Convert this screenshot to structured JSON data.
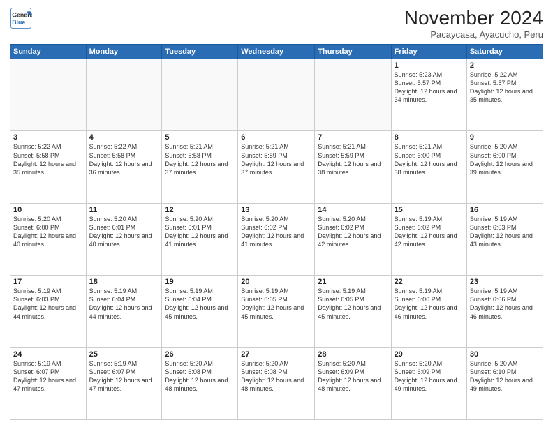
{
  "logo": {
    "general": "General",
    "blue": "Blue"
  },
  "header": {
    "month": "November 2024",
    "location": "Pacaycasa, Ayacucho, Peru"
  },
  "weekdays": [
    "Sunday",
    "Monday",
    "Tuesday",
    "Wednesday",
    "Thursday",
    "Friday",
    "Saturday"
  ],
  "weeks": [
    [
      {
        "day": "",
        "info": ""
      },
      {
        "day": "",
        "info": ""
      },
      {
        "day": "",
        "info": ""
      },
      {
        "day": "",
        "info": ""
      },
      {
        "day": "",
        "info": ""
      },
      {
        "day": "1",
        "info": "Sunrise: 5:23 AM\nSunset: 5:57 PM\nDaylight: 12 hours\nand 34 minutes."
      },
      {
        "day": "2",
        "info": "Sunrise: 5:22 AM\nSunset: 5:57 PM\nDaylight: 12 hours\nand 35 minutes."
      }
    ],
    [
      {
        "day": "3",
        "info": "Sunrise: 5:22 AM\nSunset: 5:58 PM\nDaylight: 12 hours\nand 35 minutes."
      },
      {
        "day": "4",
        "info": "Sunrise: 5:22 AM\nSunset: 5:58 PM\nDaylight: 12 hours\nand 36 minutes."
      },
      {
        "day": "5",
        "info": "Sunrise: 5:21 AM\nSunset: 5:58 PM\nDaylight: 12 hours\nand 37 minutes."
      },
      {
        "day": "6",
        "info": "Sunrise: 5:21 AM\nSunset: 5:59 PM\nDaylight: 12 hours\nand 37 minutes."
      },
      {
        "day": "7",
        "info": "Sunrise: 5:21 AM\nSunset: 5:59 PM\nDaylight: 12 hours\nand 38 minutes."
      },
      {
        "day": "8",
        "info": "Sunrise: 5:21 AM\nSunset: 6:00 PM\nDaylight: 12 hours\nand 38 minutes."
      },
      {
        "day": "9",
        "info": "Sunrise: 5:20 AM\nSunset: 6:00 PM\nDaylight: 12 hours\nand 39 minutes."
      }
    ],
    [
      {
        "day": "10",
        "info": "Sunrise: 5:20 AM\nSunset: 6:00 PM\nDaylight: 12 hours\nand 40 minutes."
      },
      {
        "day": "11",
        "info": "Sunrise: 5:20 AM\nSunset: 6:01 PM\nDaylight: 12 hours\nand 40 minutes."
      },
      {
        "day": "12",
        "info": "Sunrise: 5:20 AM\nSunset: 6:01 PM\nDaylight: 12 hours\nand 41 minutes."
      },
      {
        "day": "13",
        "info": "Sunrise: 5:20 AM\nSunset: 6:02 PM\nDaylight: 12 hours\nand 41 minutes."
      },
      {
        "day": "14",
        "info": "Sunrise: 5:20 AM\nSunset: 6:02 PM\nDaylight: 12 hours\nand 42 minutes."
      },
      {
        "day": "15",
        "info": "Sunrise: 5:19 AM\nSunset: 6:02 PM\nDaylight: 12 hours\nand 42 minutes."
      },
      {
        "day": "16",
        "info": "Sunrise: 5:19 AM\nSunset: 6:03 PM\nDaylight: 12 hours\nand 43 minutes."
      }
    ],
    [
      {
        "day": "17",
        "info": "Sunrise: 5:19 AM\nSunset: 6:03 PM\nDaylight: 12 hours\nand 44 minutes."
      },
      {
        "day": "18",
        "info": "Sunrise: 5:19 AM\nSunset: 6:04 PM\nDaylight: 12 hours\nand 44 minutes."
      },
      {
        "day": "19",
        "info": "Sunrise: 5:19 AM\nSunset: 6:04 PM\nDaylight: 12 hours\nand 45 minutes."
      },
      {
        "day": "20",
        "info": "Sunrise: 5:19 AM\nSunset: 6:05 PM\nDaylight: 12 hours\nand 45 minutes."
      },
      {
        "day": "21",
        "info": "Sunrise: 5:19 AM\nSunset: 6:05 PM\nDaylight: 12 hours\nand 45 minutes."
      },
      {
        "day": "22",
        "info": "Sunrise: 5:19 AM\nSunset: 6:06 PM\nDaylight: 12 hours\nand 46 minutes."
      },
      {
        "day": "23",
        "info": "Sunrise: 5:19 AM\nSunset: 6:06 PM\nDaylight: 12 hours\nand 46 minutes."
      }
    ],
    [
      {
        "day": "24",
        "info": "Sunrise: 5:19 AM\nSunset: 6:07 PM\nDaylight: 12 hours\nand 47 minutes."
      },
      {
        "day": "25",
        "info": "Sunrise: 5:19 AM\nSunset: 6:07 PM\nDaylight: 12 hours\nand 47 minutes."
      },
      {
        "day": "26",
        "info": "Sunrise: 5:20 AM\nSunset: 6:08 PM\nDaylight: 12 hours\nand 48 minutes."
      },
      {
        "day": "27",
        "info": "Sunrise: 5:20 AM\nSunset: 6:08 PM\nDaylight: 12 hours\nand 48 minutes."
      },
      {
        "day": "28",
        "info": "Sunrise: 5:20 AM\nSunset: 6:09 PM\nDaylight: 12 hours\nand 48 minutes."
      },
      {
        "day": "29",
        "info": "Sunrise: 5:20 AM\nSunset: 6:09 PM\nDaylight: 12 hours\nand 49 minutes."
      },
      {
        "day": "30",
        "info": "Sunrise: 5:20 AM\nSunset: 6:10 PM\nDaylight: 12 hours\nand 49 minutes."
      }
    ]
  ]
}
